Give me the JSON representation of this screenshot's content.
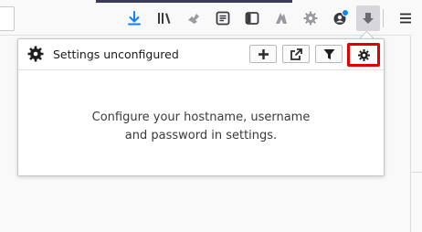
{
  "toolbar": {
    "icons": [
      "download-arrow-icon",
      "library-icon",
      "puzzle-extension-icon",
      "reader-icon",
      "sidebar-icon",
      "extension-a-icon",
      "extension-gear-icon",
      "extension-badge-icon",
      "extension-active-icon",
      "menu-icon"
    ],
    "accent": "#0a84ff"
  },
  "popup": {
    "title": "Settings unconfigured",
    "buttons": [
      "add-icon",
      "open-external-icon",
      "filter-icon",
      "settings-icon"
    ],
    "message_line1": "Configure your hostname, username",
    "message_line2": "and password in settings.",
    "highlight_color": "#e00000"
  }
}
